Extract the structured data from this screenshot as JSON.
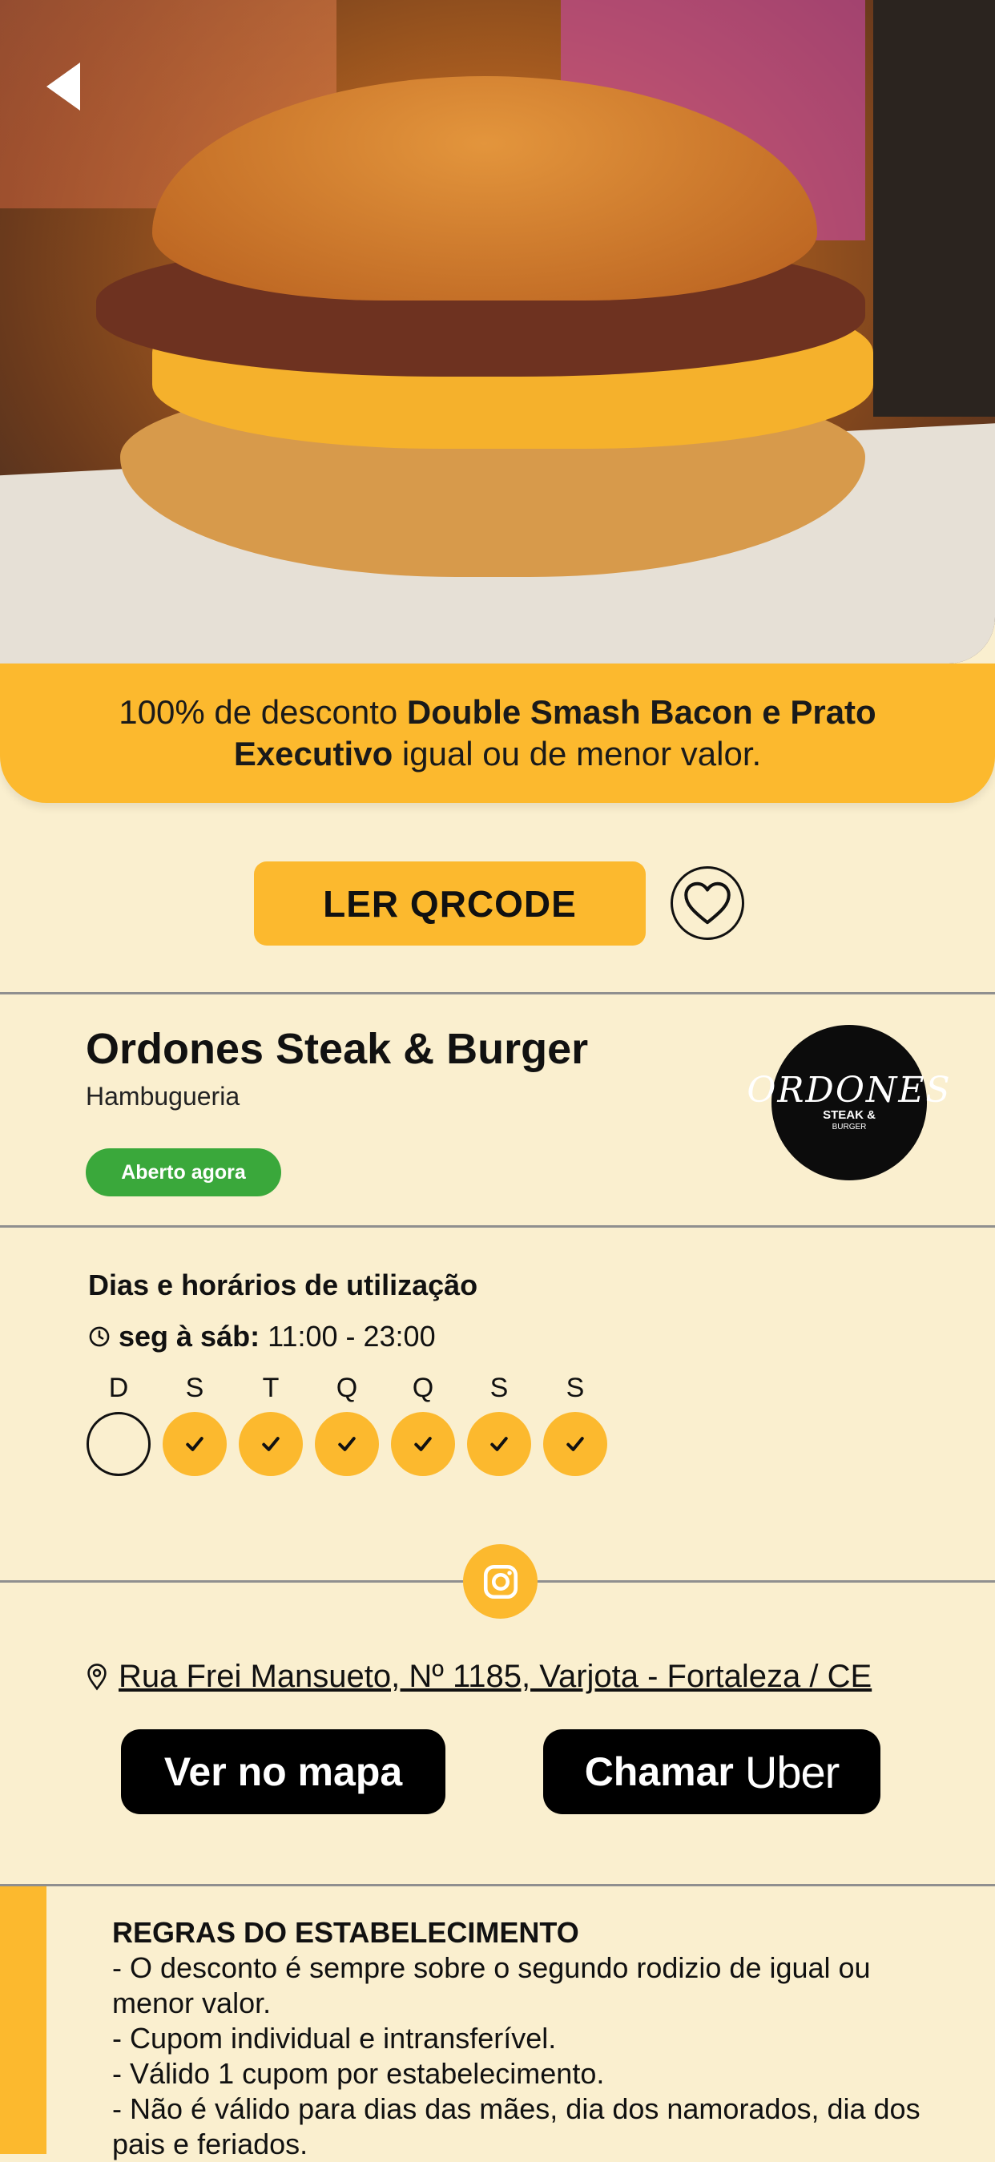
{
  "offer": {
    "prefix": "100% de desconto ",
    "bold": "Double Smash Bacon e Prato Executivo",
    "suffix": " igual ou de menor valor."
  },
  "actions": {
    "qr_label": "LER QRCODE"
  },
  "establishment": {
    "name": "Ordones Steak & Burger",
    "category": "Hambugueria",
    "status": "Aberto agora",
    "logo": {
      "line1": "ORDONES",
      "line2": "STEAK &",
      "line3": "BURGER"
    }
  },
  "schedule": {
    "title": "Dias e horários de utilização",
    "days_label": "seg à sáb:",
    "hours": " 11:00 - 23:00",
    "days": [
      {
        "label": "D",
        "active": false
      },
      {
        "label": "S",
        "active": true
      },
      {
        "label": "T",
        "active": true
      },
      {
        "label": "Q",
        "active": true
      },
      {
        "label": "Q",
        "active": true
      },
      {
        "label": "S",
        "active": true
      },
      {
        "label": "S",
        "active": true
      }
    ]
  },
  "location": {
    "address": "Rua Frei Mansueto, Nº 1185, Varjota - Fortaleza / CE",
    "map_label": "Ver no mapa",
    "uber_label": "Chamar",
    "uber_brand": "Uber"
  },
  "rules": {
    "title": "REGRAS DO ESTABELECIMENTO",
    "items": [
      "- O desconto é sempre sobre o segundo rodizio de igual ou menor valor.",
      "- Cupom individual e intransferível.",
      "- Válido 1 cupom por estabelecimento.",
      "- Não é válido para dias das mães, dia dos namorados, dia dos pais e feriados."
    ]
  },
  "colors": {
    "accent": "#fcb92e",
    "background": "#faefcf",
    "open": "#3aa83b"
  },
  "icons": [
    "back-arrow-icon",
    "heart-icon",
    "clock-icon",
    "check-icon",
    "instagram-icon",
    "location-pin-icon"
  ]
}
